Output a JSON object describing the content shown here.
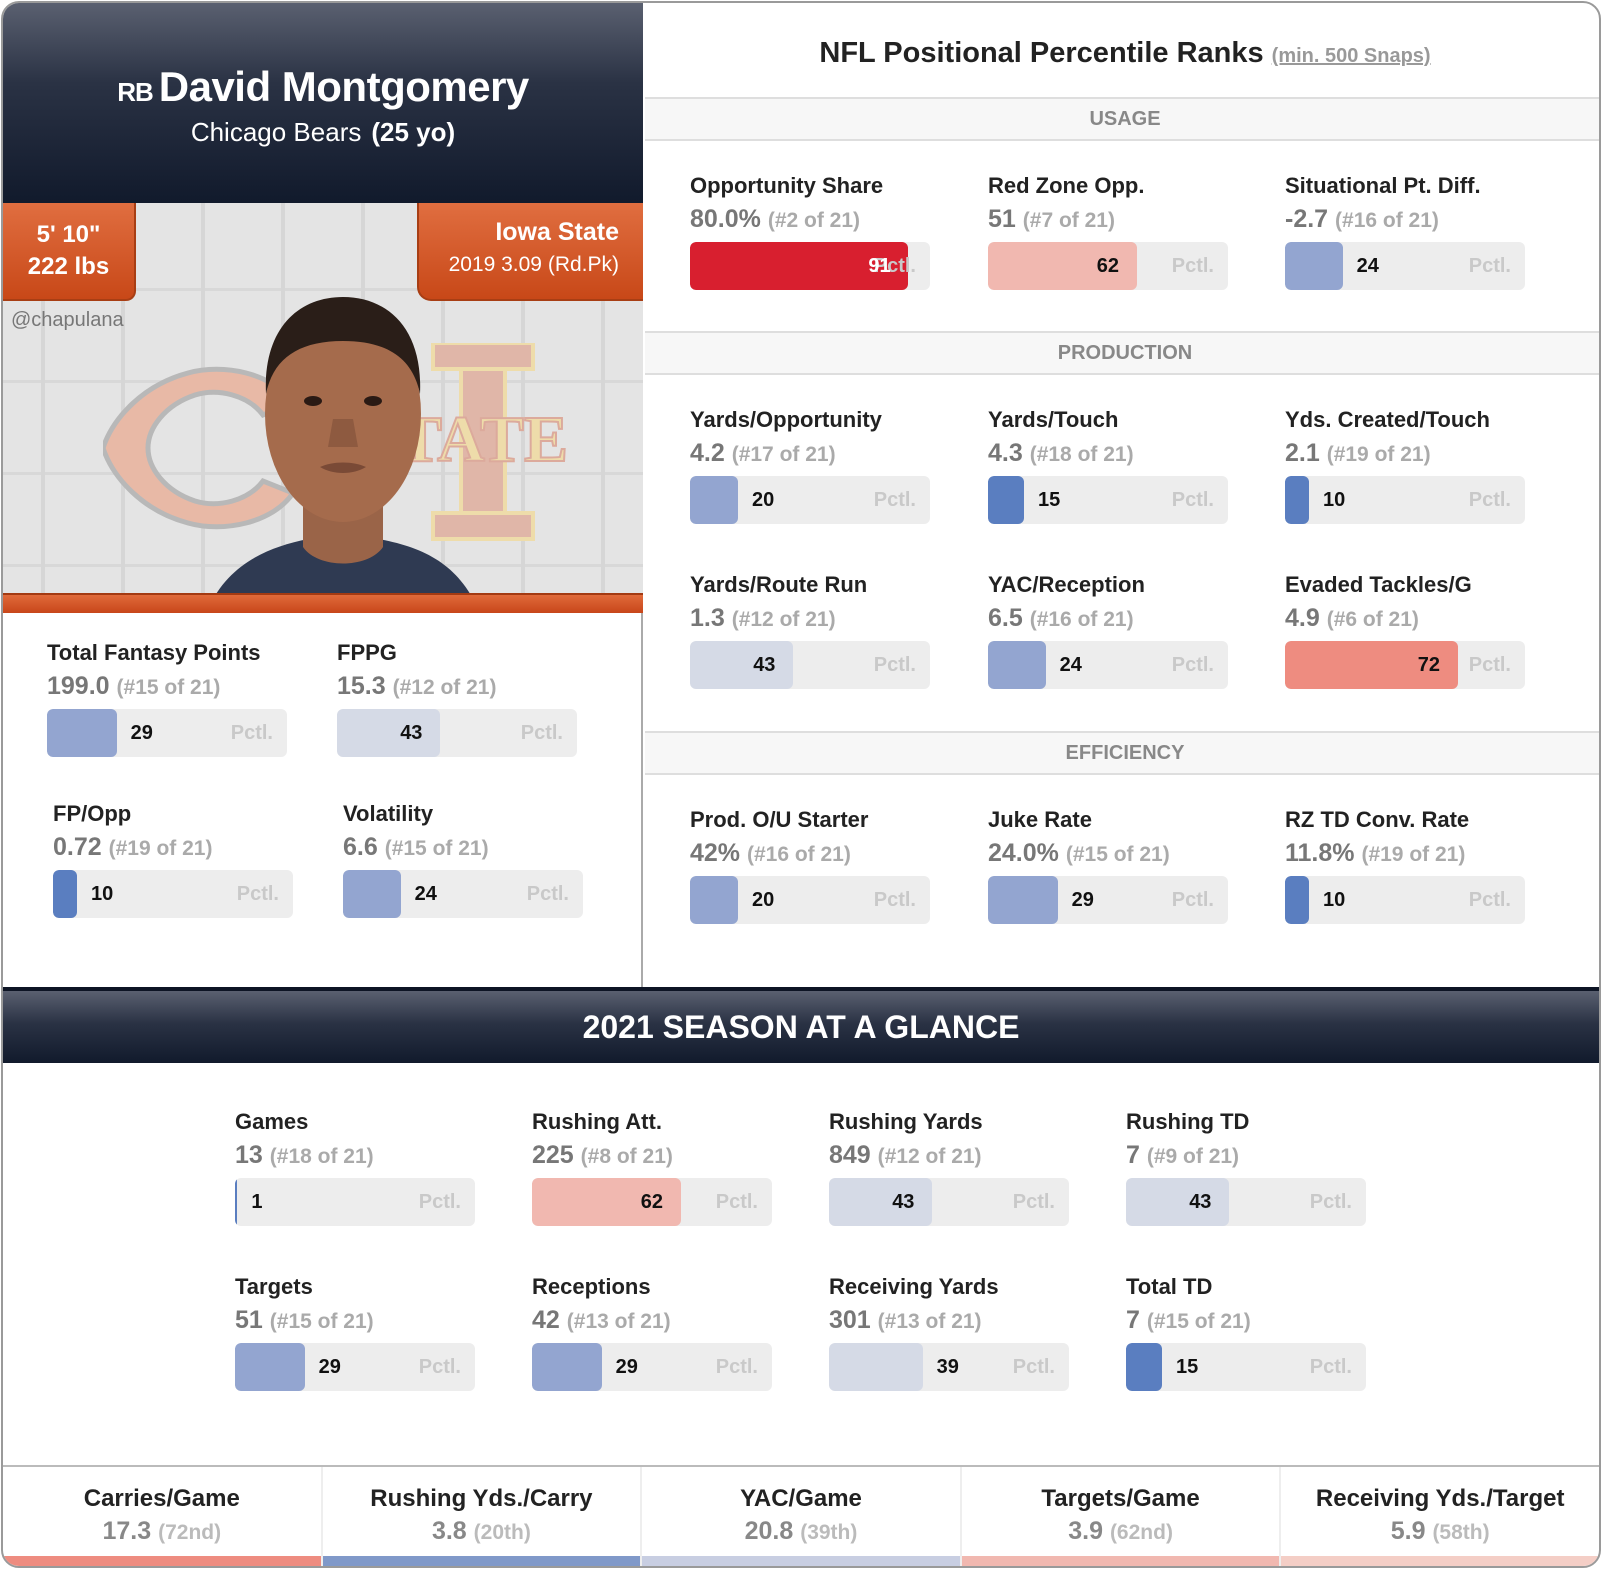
{
  "player": {
    "position": "RB",
    "name": "David Montgomery",
    "team": "Chicago Bears",
    "age": "(25 yo)",
    "height": "5' 10\"",
    "weight": "222 lbs",
    "college": "Iowa State",
    "draft": "2019 3.09 (Rd.Pk)",
    "handle": "@chapulana"
  },
  "colors": {
    "header_dark": "#111a2c",
    "accent_orange": "#d65a2a",
    "pct_high": "#d81f2f",
    "pct_mid_high": "#f1b8b0",
    "pct_mid_red": "#ee8c80",
    "pct_neutral": "#d5dae6",
    "pct_low": "#93a5d0",
    "pct_very_low": "#5a7ec0"
  },
  "fantasy": [
    {
      "label": "Total Fantasy Points",
      "value": "199.0",
      "rank": "(#15 of 21)",
      "pctl": 29
    },
    {
      "label": "FPPG",
      "value": "15.3",
      "rank": "(#12 of 21)",
      "pctl": 43
    },
    {
      "label": "FP/Opp",
      "value": "0.72",
      "rank": "(#19 of 21)",
      "pctl": 10
    },
    {
      "label": "Volatility",
      "value": "6.6",
      "rank": "(#15 of 21)",
      "pctl": 24
    }
  ],
  "percentiles": {
    "title": "NFL Positional Percentile Ranks",
    "subtitle": "(min. 500 Snaps)",
    "pctl_suffix": "Pctl.",
    "sections": [
      {
        "name": "USAGE",
        "stats": [
          {
            "label": "Opportunity Share",
            "value": "80.0%",
            "rank": "(#2 of 21)",
            "pctl": 91
          },
          {
            "label": "Red Zone Opp.",
            "value": "51",
            "rank": "(#7 of 21)",
            "pctl": 62
          },
          {
            "label": "Situational Pt. Diff.",
            "value": "-2.7",
            "rank": "(#16 of 21)",
            "pctl": 24
          }
        ]
      },
      {
        "name": "PRODUCTION",
        "stats": [
          {
            "label": "Yards/Opportunity",
            "value": "4.2",
            "rank": "(#17 of 21)",
            "pctl": 20
          },
          {
            "label": "Yards/Touch",
            "value": "4.3",
            "rank": "(#18 of 21)",
            "pctl": 15
          },
          {
            "label": "Yds. Created/Touch",
            "value": "2.1",
            "rank": "(#19 of 21)",
            "pctl": 10
          },
          {
            "label": "Yards/Route Run",
            "value": "1.3",
            "rank": "(#12 of 21)",
            "pctl": 43
          },
          {
            "label": "YAC/Reception",
            "value": "6.5",
            "rank": "(#16 of 21)",
            "pctl": 24
          },
          {
            "label": "Evaded Tackles/G",
            "value": "4.9",
            "rank": "(#6 of 21)",
            "pctl": 72
          }
        ]
      },
      {
        "name": "EFFICIENCY",
        "stats": [
          {
            "label": "Prod. O/U Starter",
            "value": "42%",
            "rank": "(#16 of 21)",
            "pctl": 20
          },
          {
            "label": "Juke Rate",
            "value": "24.0%",
            "rank": "(#15 of 21)",
            "pctl": 29
          },
          {
            "label": "RZ TD Conv. Rate",
            "value": "11.8%",
            "rank": "(#19 of 21)",
            "pctl": 10
          }
        ]
      }
    ]
  },
  "season": {
    "title": "2021 SEASON AT A GLANCE",
    "stats": [
      {
        "label": "Games",
        "value": "13",
        "rank": "(#18 of 21)",
        "pctl": 1
      },
      {
        "label": "Rushing Att.",
        "value": "225",
        "rank": "(#8 of 21)",
        "pctl": 62
      },
      {
        "label": "Rushing Yards",
        "value": "849",
        "rank": "(#12 of 21)",
        "pctl": 43
      },
      {
        "label": "Rushing TD",
        "value": "7",
        "rank": "(#9 of 21)",
        "pctl": 43
      },
      {
        "label": "Targets",
        "value": "51",
        "rank": "(#15 of 21)",
        "pctl": 29
      },
      {
        "label": "Receptions",
        "value": "42",
        "rank": "(#13 of 21)",
        "pctl": 29
      },
      {
        "label": "Receiving Yards",
        "value": "301",
        "rank": "(#13 of 21)",
        "pctl": 39
      },
      {
        "label": "Total TD",
        "value": "7",
        "rank": "(#15 of 21)",
        "pctl": 15
      }
    ]
  },
  "per_game": [
    {
      "label": "Carries/Game",
      "value": "17.3",
      "rank": "(72nd)",
      "pctl": 72
    },
    {
      "label": "Rushing Yds./Carry",
      "value": "3.8",
      "rank": "(20th)",
      "pctl": 20
    },
    {
      "label": "YAC/Game",
      "value": "20.8",
      "rank": "(39th)",
      "pctl": 39
    },
    {
      "label": "Targets/Game",
      "value": "3.9",
      "rank": "(62nd)",
      "pctl": 62
    },
    {
      "label": "Receiving Yds./Target",
      "value": "5.9",
      "rank": "(58th)",
      "pctl": 58
    }
  ]
}
